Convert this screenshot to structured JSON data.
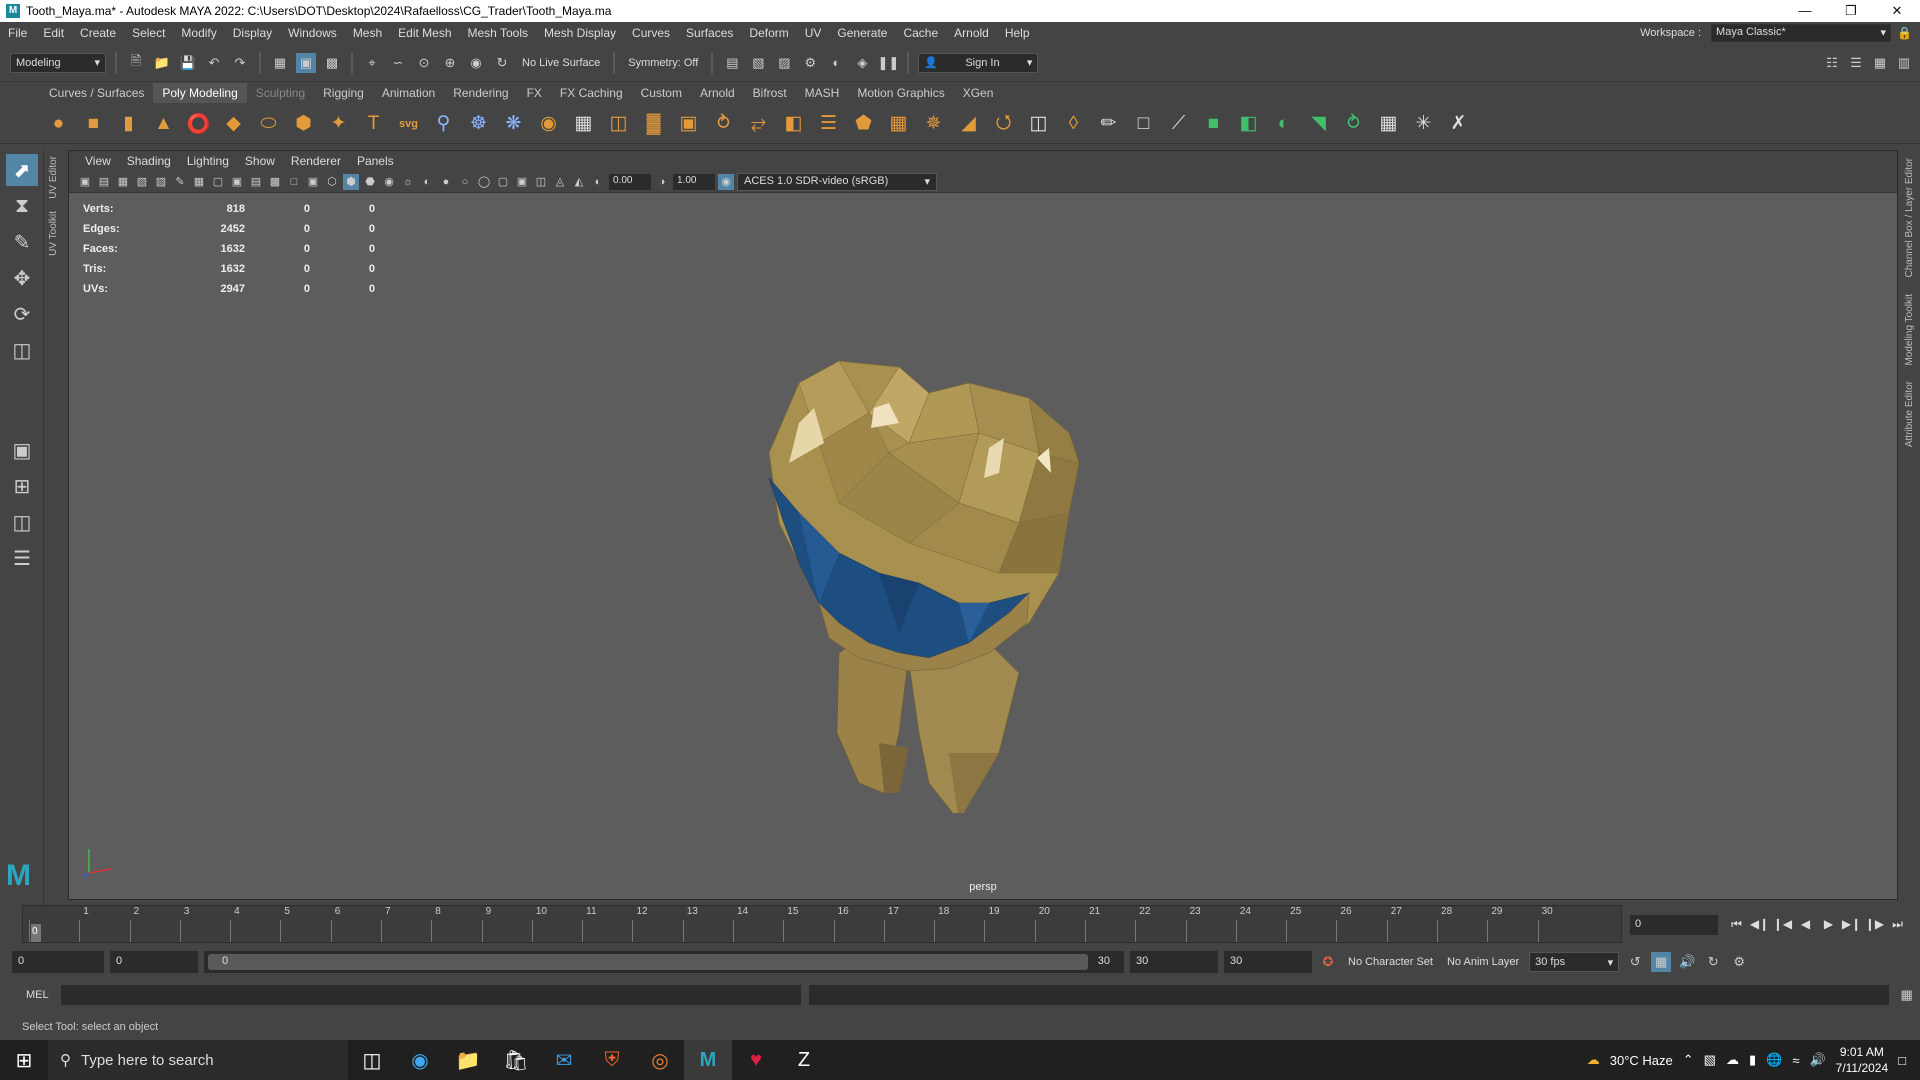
{
  "window": {
    "title": "Tooth_Maya.ma* - Autodesk MAYA 2022: C:\\Users\\DOT\\Desktop\\2024\\Rafaelloss\\CG_Trader\\Tooth_Maya.ma"
  },
  "menu": [
    "File",
    "Edit",
    "Create",
    "Select",
    "Modify",
    "Display",
    "Windows",
    "Mesh",
    "Edit Mesh",
    "Mesh Tools",
    "Mesh Display",
    "Curves",
    "Surfaces",
    "Deform",
    "UV",
    "Generate",
    "Cache",
    "Arnold",
    "Help"
  ],
  "workspace": {
    "label": "Workspace :",
    "value": "Maya Classic*"
  },
  "status_line": {
    "mode": "Modeling",
    "live_surface": "No Live Surface",
    "symmetry": "Symmetry: Off",
    "sign_in": "Sign In"
  },
  "shelf_tabs": [
    "Curves / Surfaces",
    "Poly Modeling",
    "Sculpting",
    "Rigging",
    "Animation",
    "Rendering",
    "FX",
    "FX Caching",
    "Custom",
    "Arnold",
    "Bifrost",
    "MASH",
    "Motion Graphics",
    "XGen"
  ],
  "shelf_active": "Poly Modeling",
  "side_tabs_left": [
    "UV Editor",
    "UV Toolkit"
  ],
  "side_tabs_right": [
    "Channel Box / Layer Editor",
    "Modeling Toolkit",
    "Attribute Editor"
  ],
  "panel_menu": [
    "View",
    "Shading",
    "Lighting",
    "Show",
    "Renderer",
    "Panels"
  ],
  "panel_tools": {
    "exposure": "0.00",
    "gamma": "1.00",
    "color_space": "ACES 1.0 SDR-video (sRGB)"
  },
  "hud": [
    {
      "label": "Verts:",
      "v1": "818",
      "v2": "0",
      "v3": "0"
    },
    {
      "label": "Edges:",
      "v1": "2452",
      "v2": "0",
      "v3": "0"
    },
    {
      "label": "Faces:",
      "v1": "1632",
      "v2": "0",
      "v3": "0"
    },
    {
      "label": "Tris:",
      "v1": "1632",
      "v2": "0",
      "v3": "0"
    },
    {
      "label": "UVs:",
      "v1": "2947",
      "v2": "0",
      "v3": "0"
    }
  ],
  "camera": "persp",
  "time_slider": {
    "ticks": [
      "0",
      "1",
      "2",
      "3",
      "4",
      "5",
      "6",
      "7",
      "8",
      "9",
      "10",
      "11",
      "12",
      "13",
      "14",
      "15",
      "16",
      "17",
      "18",
      "19",
      "20",
      "21",
      "22",
      "23",
      "24",
      "25",
      "26",
      "27",
      "28",
      "29",
      "30"
    ],
    "current_frame": "0",
    "frame_field": "0"
  },
  "range": {
    "start": "0",
    "anim_start": "0",
    "slider_left": "0",
    "slider_right": "30",
    "end": "30",
    "anim_end": "30",
    "character_set": "No Character Set",
    "anim_layer": "No Anim Layer",
    "fps": "30 fps"
  },
  "command_line": {
    "lang": "MEL"
  },
  "help_line": "Select Tool: select an object",
  "taskbar": {
    "search_placeholder": "Type here to search",
    "weather": "30°C  Haze",
    "time": "9:01 AM",
    "date": "7/11/2024"
  },
  "colors": {
    "tooth": "#a8904f",
    "band": "#1e4d80",
    "viewport_bg": "#5d5d5d",
    "select_highlight": "#5285a6"
  }
}
